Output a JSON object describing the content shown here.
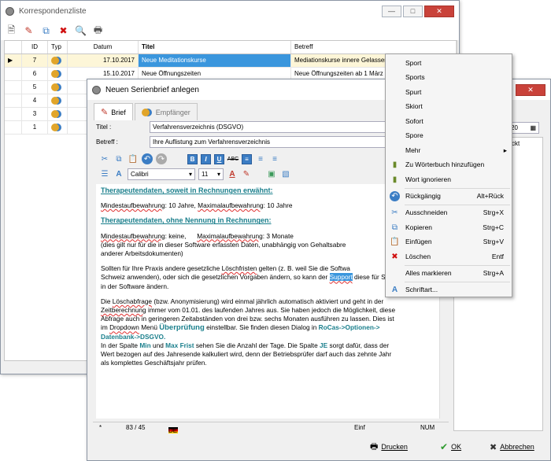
{
  "list_window": {
    "title": "Korrespondenzliste",
    "columns": [
      "ID",
      "Typ",
      "Datum",
      "Titel",
      "Betreff"
    ],
    "rows": [
      {
        "id": "7",
        "datum": "17.10.2017",
        "titel": "Neue Meditationskurse",
        "betreff": "Mediationskurse innere Gelassenheit"
      },
      {
        "id": "6",
        "datum": "15.10.2017",
        "titel": "Neue Öffnungszeiten",
        "betreff": "Neue Öffnungszeiten ab 1 März 20"
      },
      {
        "id": "5",
        "datum": "01",
        "titel": "",
        "betreff": ""
      },
      {
        "id": "4",
        "datum": "03",
        "titel": "",
        "betreff": ""
      },
      {
        "id": "3",
        "datum": "02",
        "titel": "",
        "betreff": ""
      },
      {
        "id": "1",
        "datum": "20",
        "titel": "",
        "betreff": ""
      }
    ]
  },
  "dialog": {
    "title": "Neuen Serienbrief anlegen",
    "tabs": [
      "Brief",
      "Empfänger"
    ],
    "titel_label": "Titel :",
    "titel_value": "Verfahrensverzeichnis (DSGVO)",
    "betreff_label": "Betreff :",
    "betreff_value": "Ihre Auflistung zum Verfahrensverzeichnis",
    "font_name": "Calibri",
    "font_size": "11",
    "right_fragment_date": "20",
    "right_fragment_text": "ckt",
    "status": {
      "star": "*",
      "position": "83 / 45",
      "lang": "DE",
      "mode": "Einf",
      "num": "NUM"
    },
    "buttons": {
      "print": "Drucken",
      "ok": "OK",
      "cancel": "Abbrechen"
    }
  },
  "document": {
    "h1": "Therapeutendaten, soweit in Rechnungen erwähnt:",
    "p1_a": "Mindestaufbewahrung",
    "p1_b": ": 10 Jahre, ",
    "p1_c": "Maximalaufbewahrung",
    "p1_d": ": 10 Jahre",
    "h2": "Therapeutendaten, ohne Nennung in Rechnungen:",
    "p2_a": "Mindestaufbewahrung",
    "p2_b": ": keine,      ",
    "p2_c": "Maximalaufbewahrung",
    "p2_d": ": 3 Monate",
    "p2_e": "(dies gilt nur für die in dieser Software erfassten Daten, unabhängig von Gehaltsabre",
    "p2_f": "anderer Arbeitsdokumenten)",
    "p3_a": "Sollten für Ihre Praxis andere gesetzliche ",
    "p3_b": "Löschfristen",
    "p3_c": " gelten (z. B. weil Sie die Softwa",
    "p3_d": "Schweiz anwenden), oder sich die gesetzlichen Vorgaben ändern, so kann der ",
    "p3_e": "Support",
    "p3_f": " diese für Sie",
    "p3_g": "in der Software ändern.",
    "p4_a": "Die ",
    "p4_b": "Löschabfrage",
    "p4_c": " (bzw. Anonymisierung) wird einmal jährlich automatisch aktiviert und geht in der",
    "p4_d": "Zeitberechnung",
    "p4_e": " immer vom 01.01. des laufenden Jahres aus. Sie haben jedoch die Möglichkeit, diese",
    "p4_f": "Abfrage auch in geringeren Zeitabständen von drei bzw. sechs Monaten ausführen zu lassen. Dies ist",
    "p4_g": "im ",
    "p4_h": "Dropdown",
    "p4_i": " Menü ",
    "p4_j": "Überprüfung",
    "p4_k": " einstellbar. Sie finden diesen Dialog in ",
    "p4_l": "RoCas->Optionen->",
    "p4_m": "Datenbank->DSGVO.",
    "p5_a": "In der Spalte ",
    "p5_b": "Min",
    "p5_c": " und ",
    "p5_d": "Max Frist",
    "p5_e": " sehen Sie die Anzahl der Tage. Die Spalte ",
    "p5_f": "JE",
    "p5_g": " sorgt dafür, dass der",
    "p5_h": "Wert bezogen auf des Jahresende kalkuliert wird, denn der Betriebsprüfer darf auch das zehnte Jahr",
    "p5_i": "als komplettes Geschäftsjahr prüfen."
  },
  "context_menu": {
    "suggestions": [
      "Sport",
      "Sports",
      "Spurt",
      "Skiort",
      "Sofort",
      "Spore"
    ],
    "mehr": "Mehr",
    "add_dict": "Zu Wörterbuch hinzufügen",
    "ignore": "Wort ignorieren",
    "undo": "Rückgängig",
    "undo_sc": "Alt+Rück",
    "cut": "Ausschneiden",
    "cut_sc": "Strg+X",
    "copy": "Kopieren",
    "copy_sc": "Strg+C",
    "paste": "Einfügen",
    "paste_sc": "Strg+V",
    "delete": "Löschen",
    "delete_sc": "Entf",
    "select_all": "Alles markieren",
    "select_all_sc": "Strg+A",
    "font": "Schriftart..."
  }
}
